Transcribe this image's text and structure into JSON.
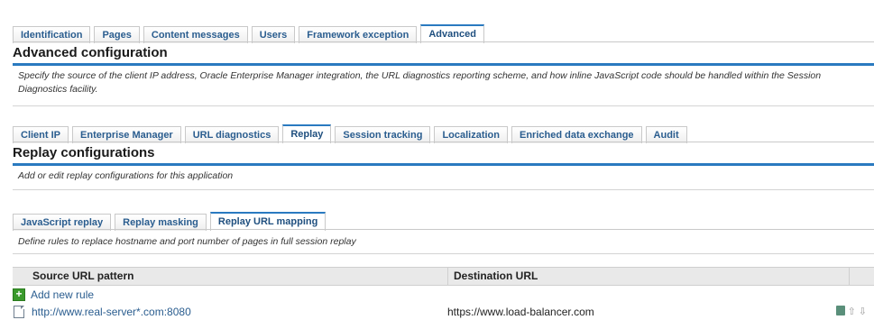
{
  "top_tabs": [
    "Identification",
    "Pages",
    "Content messages",
    "Users",
    "Framework exception",
    "Advanced"
  ],
  "top_active": "Advanced",
  "advanced": {
    "title": "Advanced configuration",
    "description": "Specify the source of the client IP address, Oracle Enterprise Manager integration, the URL diagnostics reporting scheme, and how inline JavaScript code should be handled within the Session Diagnostics facility."
  },
  "second_tabs": [
    "Client IP",
    "Enterprise Manager",
    "URL diagnostics",
    "Replay",
    "Session tracking",
    "Localization",
    "Enriched data exchange",
    "Audit"
  ],
  "second_active": "Replay",
  "replay": {
    "title": "Replay configurations",
    "description": "Add or edit replay configurations for this application"
  },
  "third_tabs": [
    "JavaScript replay",
    "Replay masking",
    "Replay URL mapping"
  ],
  "third_active": "Replay URL mapping",
  "mapping": {
    "description": "Define rules to replace hostname and port number of pages in full session replay"
  },
  "grid": {
    "col_source": "Source URL pattern",
    "col_destination": "Destination URL",
    "add_label": "Add new rule",
    "rows": [
      {
        "source": "http://www.real-server*.com:8080",
        "destination": "https://www.load-balancer.com"
      }
    ]
  }
}
